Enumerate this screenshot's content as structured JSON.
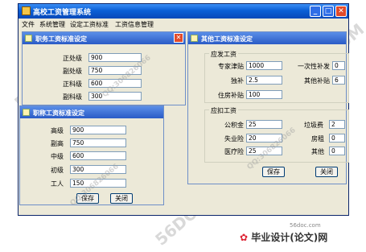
{
  "app": {
    "title": "高校工资管理系统",
    "menu": [
      "文件",
      "系统管理",
      "设定工资标准",
      "工资信息管理"
    ],
    "controls": {
      "minimize": "_",
      "maximize": "□",
      "close": "✕"
    }
  },
  "duty_window": {
    "title": "职务工资标准设定",
    "fields": [
      {
        "label": "正处级",
        "value": "900"
      },
      {
        "label": "副处级",
        "value": "750"
      },
      {
        "label": "正科级",
        "value": "600"
      },
      {
        "label": "副科级",
        "value": "300"
      }
    ]
  },
  "title_window": {
    "title": "职称工资标准设定",
    "fields": [
      {
        "label": "高级",
        "value": "900"
      },
      {
        "label": "副高",
        "value": "750"
      },
      {
        "label": "中级",
        "value": "600"
      },
      {
        "label": "初级",
        "value": "300"
      },
      {
        "label": "工人",
        "value": "150"
      }
    ],
    "save": "保存",
    "close": "关闭"
  },
  "other_window": {
    "title": "其他工资标准设定",
    "payable_group": "应发工资",
    "payable_left": [
      {
        "label": "专家津贴",
        "value": "1000"
      },
      {
        "label": "独补",
        "value": "2.5"
      },
      {
        "label": "住房补贴",
        "value": "100"
      }
    ],
    "payable_right": [
      {
        "label": "一次性补发",
        "value": "0"
      },
      {
        "label": "其他补贴",
        "value": "6"
      }
    ],
    "deduct_group": "应扣工资",
    "deduct_left": [
      {
        "label": "公积金",
        "value": "25"
      },
      {
        "label": "失业险",
        "value": "20"
      },
      {
        "label": "医疗险",
        "value": "25"
      }
    ],
    "deduct_right": [
      {
        "label": "垃圾费",
        "value": "2"
      },
      {
        "label": "房租",
        "value": "0"
      },
      {
        "label": "其他",
        "value": "0"
      }
    ],
    "save": "保存",
    "close": "关闭"
  },
  "watermarks": [
    "56DOC.COM",
    "QQ:306826066"
  ],
  "footer": {
    "url": "56doc.com",
    "logo": "毕业设计(论文)网"
  }
}
